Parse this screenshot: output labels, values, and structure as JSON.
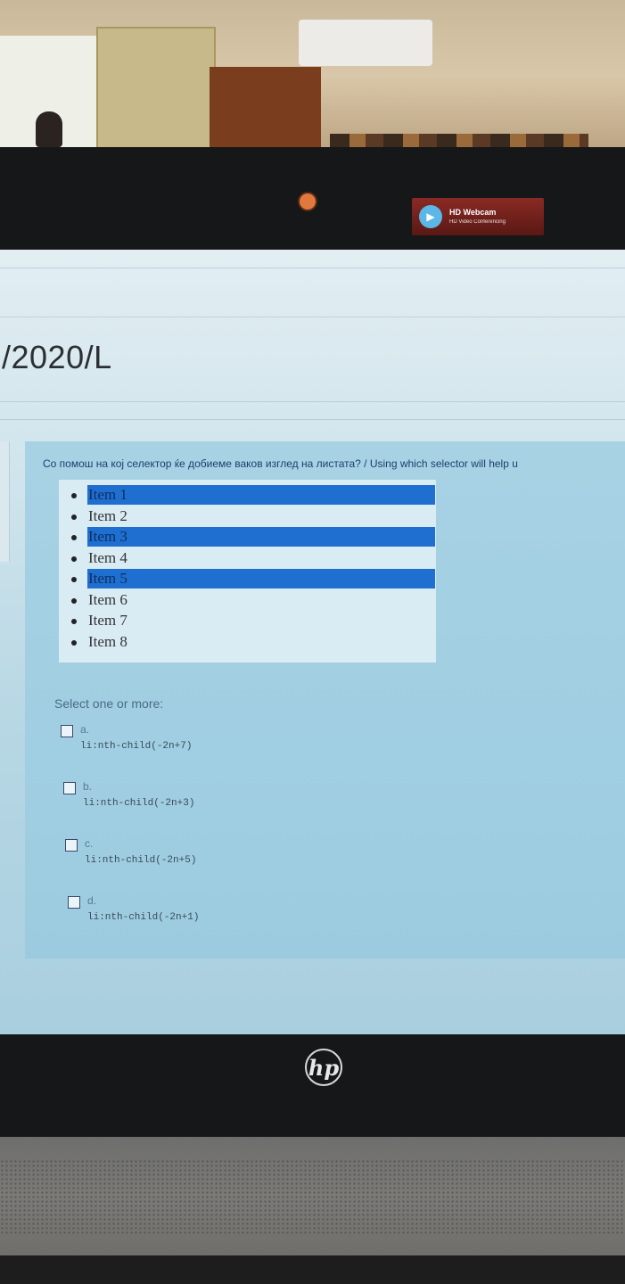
{
  "webcam": {
    "title": "HD Webcam",
    "subtitle": "HD Video Conferencing"
  },
  "laptop": {
    "logo": "hp"
  },
  "page": {
    "course_title": "/2020/L"
  },
  "question": {
    "text": "Со помош на кој селектор ќе добиеме ваков изглед на листата? / Using which selector will help u",
    "list_items": [
      {
        "label": "Item 1",
        "highlighted": true
      },
      {
        "label": "Item 2",
        "highlighted": false
      },
      {
        "label": "Item 3",
        "highlighted": true
      },
      {
        "label": "Item 4",
        "highlighted": false
      },
      {
        "label": "Item 5",
        "highlighted": true
      },
      {
        "label": "Item 6",
        "highlighted": false
      },
      {
        "label": "Item 7",
        "highlighted": false
      },
      {
        "label": "Item 8",
        "highlighted": false
      }
    ],
    "highlight_color": "#1f6fd0",
    "select_prompt": "Select one or more:",
    "options": [
      {
        "letter": "a.",
        "code": "li:nth-child(-2n+7)",
        "checked": false
      },
      {
        "letter": "b.",
        "code": "li:nth-child(-2n+3)",
        "checked": false
      },
      {
        "letter": "c.",
        "code": "li:nth-child(-2n+5)",
        "checked": false
      },
      {
        "letter": "d.",
        "code": "li:nth-child(-2n+1)",
        "checked": false
      }
    ]
  }
}
